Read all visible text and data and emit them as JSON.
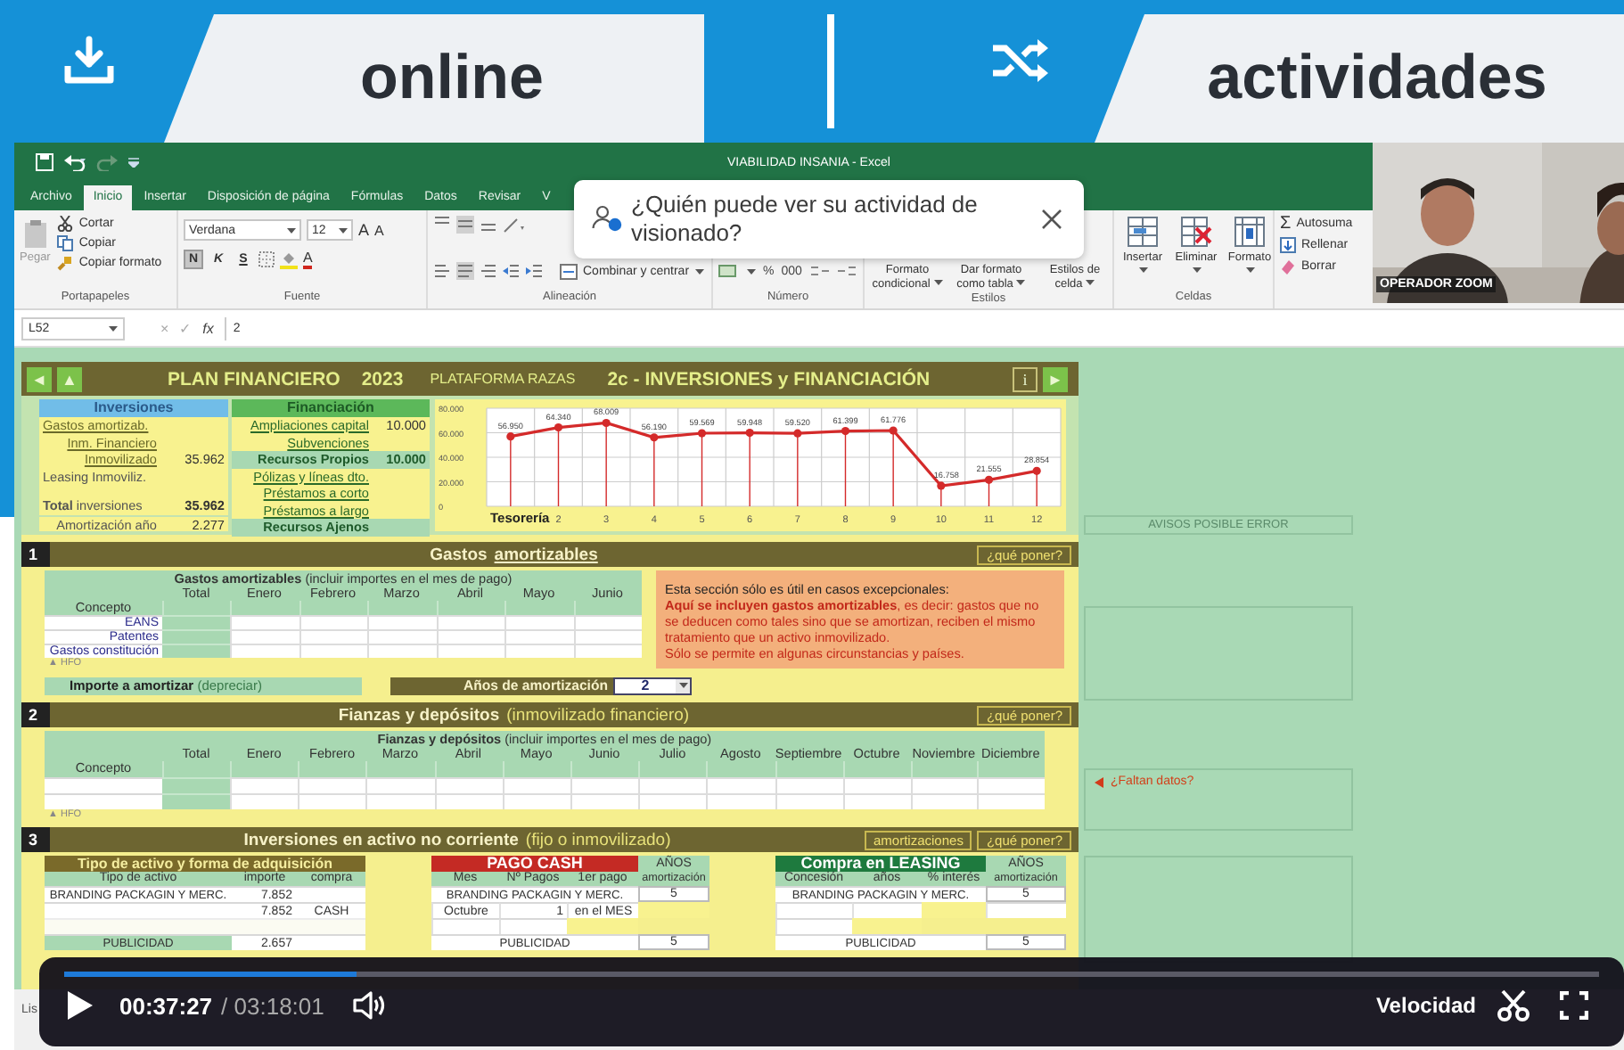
{
  "header": {
    "tiles": [
      {
        "kind": "download",
        "label": "online"
      },
      {
        "kind": "shuffle",
        "label": "actividades"
      }
    ]
  },
  "excel": {
    "title": "VIABILIDAD INSANIA - Excel",
    "tabs": [
      {
        "label": "Archivo",
        "selected": false
      },
      {
        "label": "Inicio",
        "selected": true
      },
      {
        "label": "Insertar",
        "selected": false
      },
      {
        "label": "Disposición de página",
        "selected": false
      },
      {
        "label": "Fórmulas",
        "selected": false
      },
      {
        "label": "Datos",
        "selected": false
      },
      {
        "label": "Revisar",
        "selected": false
      },
      {
        "label": "V",
        "selected": false
      }
    ],
    "popup": {
      "text": "¿Quién puede ver su actividad de visionado?"
    },
    "ribbon": [
      {
        "kind": "clipboard",
        "label": "Portapapeles",
        "paste": "Pegar",
        "items": [
          "Cortar",
          "Copiar",
          "Copiar formato"
        ]
      },
      {
        "kind": "font",
        "label": "Fuente",
        "font": "Verdana",
        "size": "12",
        "grow": "A",
        "shrink": "A",
        "styles": [
          "N",
          "K",
          "S"
        ],
        "color_letter": "A"
      },
      {
        "kind": "align",
        "label": "Alineación",
        "merge": "Combinar y centrar"
      },
      {
        "kind": "number",
        "label": "Número",
        "symbols": [
          "%",
          "000"
        ]
      },
      {
        "kind": "styles",
        "label": "Estilos",
        "items": [
          "Formato condicional",
          "Dar formato como tabla",
          "Estilos de celda"
        ]
      },
      {
        "kind": "cells",
        "label": "Celdas",
        "items": [
          "Insertar",
          "Eliminar",
          "Formato"
        ]
      },
      {
        "kind": "editing",
        "items": [
          {
            "glyph": "Σ",
            "text": "Autosuma"
          },
          {
            "text": "Rellenar"
          },
          {
            "text": "Borrar"
          }
        ]
      }
    ],
    "formula_bar": {
      "name_box": "L52",
      "buttons": [
        "×",
        "✓",
        "fx"
      ],
      "value": "2"
    },
    "webcam": {
      "label": "OPERADOR ZOOM"
    },
    "status": "Lis"
  },
  "sheet": {
    "banner": {
      "nav_left": [
        "◄",
        "▲"
      ],
      "title": "PLAN FINANCIERO",
      "year": "2023",
      "subtitle": "PLATAFORMA RAZAS",
      "section": "2c - INVERSIONES y FINANCIACIÓN",
      "nav_right": [
        "i",
        "►"
      ]
    },
    "investments": {
      "title": "Inversiones",
      "rows": [
        {
          "kind": "link",
          "label": "Gastos amortizab."
        },
        {
          "kind": "link",
          "label": "Inm. Financiero"
        },
        {
          "kind": "link",
          "label": "Inmovilizado",
          "value": "35.962"
        },
        {
          "kind": "text",
          "label": "Leasing Inmoviliz."
        },
        {
          "kind": "total",
          "label": "**Total** inversiones",
          "value": "35.962"
        },
        {
          "kind": "annual",
          "label": "Amortización año",
          "value": "2.277"
        }
      ]
    },
    "financing": {
      "title": "Financiación",
      "rows": [
        {
          "kind": "link",
          "label": "Ampliaciones capital",
          "value": "10.000"
        },
        {
          "kind": "link",
          "label": "Subvenciones"
        },
        {
          "kind": "subtotal",
          "label": "Recursos Propios",
          "value": "10.000"
        },
        {
          "kind": "link",
          "label": "Pólizas y líneas dto."
        },
        {
          "kind": "link",
          "label": "Préstamos a corto"
        },
        {
          "kind": "link",
          "label": "Préstamos a largo"
        },
        {
          "kind": "subtotal",
          "label": "Recursos Ajenos"
        }
      ]
    },
    "chart_data": {
      "type": "line",
      "categories": [
        "Tesorería",
        "2",
        "3",
        "4",
        "5",
        "6",
        "7",
        "8",
        "9",
        "10",
        "11",
        "12"
      ],
      "series": [
        {
          "color": "#d42a2a",
          "marker": "circle",
          "values": [
            56950,
            64340,
            68009,
            56190,
            59569,
            59948,
            59520,
            61399,
            61776,
            16758,
            21555,
            28854
          ],
          "value_labels": [
            "56.950",
            "64.340",
            "68.009",
            "56.190",
            "59.569",
            "59.948",
            "59.520",
            "61.399",
            "61.776",
            "16.758",
            "21.555",
            "28.854"
          ]
        }
      ],
      "ylim": [
        0,
        80000
      ],
      "yticks": [
        {
          "value": 0,
          "label": "0"
        },
        {
          "value": 20000,
          "label": "20.000"
        },
        {
          "value": 40000,
          "label": "40.000"
        },
        {
          "value": 60000,
          "label": "60.000"
        },
        {
          "value": 80000,
          "label": "80.000"
        }
      ],
      "grid": true
    },
    "sections": [
      {
        "kind": "expenses",
        "number": "1",
        "title": [
          {
            "kind": "plain",
            "text": "Gastos"
          },
          {
            "kind": "link",
            "text": "amortizables"
          }
        ],
        "buttons": [
          "¿qué poner?"
        ],
        "table": {
          "caption": "**Gastos amortizables** (incluir importes en el mes de pago)",
          "columns": [
            "Total",
            "Enero",
            "Febrero",
            "Marzo",
            "Abril",
            "Mayo",
            "Junio"
          ],
          "rows": [
            {
              "kind": "head",
              "label": "Concepto"
            },
            {
              "kind": "item",
              "label": "EANS"
            },
            {
              "kind": "item",
              "label": "Patentes"
            },
            {
              "kind": "item",
              "label": "Gastos constitución"
            }
          ],
          "footer": "▲ HFO"
        },
        "note": [
          {
            "kind": "intro",
            "text": "Esta sección sólo es útil en casos excepcionales:"
          },
          {
            "kind": "warn",
            "text": "**Aquí se incluyen gastos amortizables**, es decir: gastos que no se deducen como tales sino que se amortizan, reciben el mismo tratamiento que un activo inmovilizado."
          },
          {
            "kind": "warn",
            "text": "Sólo se permite en algunas circunstancias y países."
          }
        ],
        "amortization": {
          "label": "**Importe a amortizar** (depreciar)",
          "years_label": "Años de amortización",
          "years": "2"
        }
      },
      {
        "kind": "deposits",
        "number": "2",
        "title": [
          {
            "kind": "plain",
            "text": "Fianzas y depósitos"
          },
          {
            "kind": "note",
            "text": "(inmovilizado financiero)"
          }
        ],
        "buttons": [
          "¿qué poner?"
        ],
        "table": {
          "caption": "**Fianzas y depósitos** (incluir importes en el mes de pago)",
          "columns": [
            "Total",
            "Enero",
            "Febrero",
            "Marzo",
            "Abril",
            "Mayo",
            "Junio",
            "Julio",
            "Agosto",
            "Septiembre",
            "Octubre",
            "Noviembre",
            "Diciembre"
          ],
          "rows": [
            {
              "kind": "head",
              "label": "Concepto"
            },
            {
              "kind": "blank"
            },
            {
              "kind": "blank"
            }
          ],
          "footer": "▲ HFO"
        }
      },
      {
        "kind": "assets",
        "number": "3",
        "title": [
          {
            "kind": "plain",
            "text": "Inversiones en activo no corriente"
          },
          {
            "kind": "note",
            "text": "(fijo o inmovilizado)"
          }
        ],
        "buttons": [
          "amortizaciones",
          "¿qué poner?"
        ],
        "asset_table": {
          "title": "Tipo de activo y forma de adquisición",
          "color": "#7a6a2a",
          "columns": [
            "Tipo de activo",
            "importe",
            "compra"
          ],
          "rows": [
            {
              "kind": "data",
              "asset": "BRANDING PACKAGIN Y MERC.",
              "amount": "7.852"
            },
            {
              "kind": "data",
              "amount": "7.852",
              "purchase": "CASH"
            },
            {
              "kind": "blank"
            },
            {
              "kind": "data",
              "asset": "PUBLICIDAD",
              "amount": "2.657"
            }
          ]
        },
        "payment_tables": [
          {
            "title": "PAGO CASH",
            "color": "#c42a24",
            "side": "AÑOS",
            "columns": [
              "Mes",
              "Nº Pagos",
              "1er pago",
              "amortización"
            ],
            "rows": [
              {
                "kind": "merged",
                "text": "BRANDING PACKAGIN Y MERC.",
                "years": "5"
              },
              {
                "kind": "data",
                "month": "Octubre",
                "payments": "1",
                "first_payment": "en el MES"
              },
              {
                "kind": "blank"
              },
              {
                "kind": "merged",
                "text": "PUBLICIDAD",
                "years": "5"
              }
            ]
          },
          {
            "title": "Compra en LEASING",
            "color": "#1e7a3e",
            "side": "AÑOS",
            "columns": [
              "Concesión",
              "años",
              "% interés",
              "amortización"
            ],
            "rows": [
              {
                "kind": "merged",
                "text": "BRANDING PACKAGIN Y MERC.",
                "years": "5"
              },
              {
                "kind": "blank"
              },
              {
                "kind": "blank"
              },
              {
                "kind": "merged",
                "text": "PUBLICIDAD",
                "years": "5"
              }
            ]
          }
        ]
      }
    ],
    "side_panel": {
      "warning_box": "AVISOS POSIBLE ERROR",
      "alerts": [
        "¿Faltan datos?"
      ]
    }
  },
  "player": {
    "playing": false,
    "level": 0.19,
    "current": "00:37:27",
    "duration": "/ 03:18:01",
    "speed": "Velocidad"
  }
}
